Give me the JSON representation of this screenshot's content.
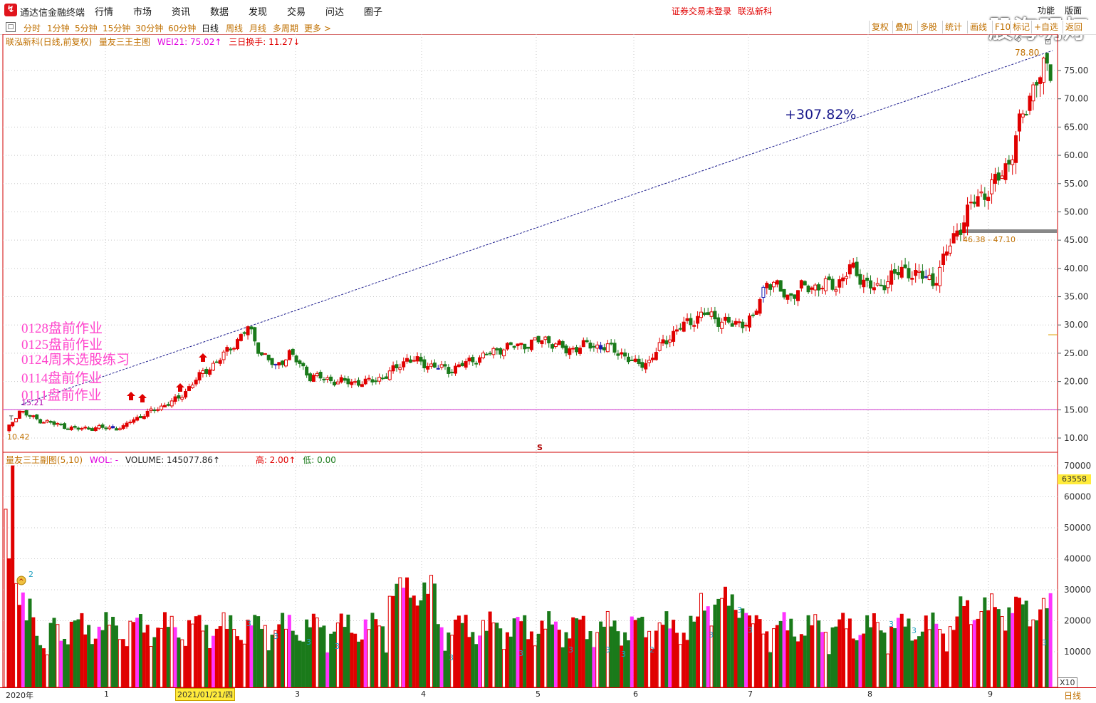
{
  "app": {
    "title": "通达信金融终端",
    "menu": [
      "行情",
      "市场",
      "资讯",
      "数据",
      "发现",
      "交易",
      "问达",
      "圈子"
    ],
    "status_login": "证券交易未登录",
    "stock_name": "联泓新科",
    "right_menu": [
      "功能",
      "版面"
    ],
    "watermark": "股海明灯"
  },
  "periods": [
    "分时",
    "1分钟",
    "5分钟",
    "15分钟",
    "30分钟",
    "60分钟",
    "日线",
    "周线",
    "月线",
    "多周期",
    "更多 >"
  ],
  "active_period": "日线",
  "toolbar": [
    "复权",
    "叠加",
    "多股",
    "统计",
    "画线",
    "F10",
    "标记",
    "+自选",
    "返回"
  ],
  "main_legend": {
    "title": "联泓新科(日线,前复权)",
    "indicator": "量友三王主图",
    "wei": "WEI21: 75.02↑",
    "turnover": "三日换手: 11.27↓"
  },
  "sub_legend": {
    "title": "量友三王副图(5,10)",
    "wol": "WOL: -",
    "volume": "VOLUME: 145077.86↑",
    "high": "高: 2.00↑",
    "low": "低: 0.00"
  },
  "homework": [
    "0128盘前作业",
    "0125盘前作业",
    "0124周末选股练习",
    "0114盘前作业",
    "0111盘前作业"
  ],
  "annotations": {
    "pct_change": "+307.82%",
    "high_price": "78.80",
    "low_price": "10.42",
    "start_price": "15.21",
    "gap_label": "46.38 - 47.10",
    "s_marker": "S",
    "t_marker": "T"
  },
  "price_axis": [
    "75.00",
    "70.00",
    "65.00",
    "60.00",
    "55.00",
    "50.00",
    "45.00",
    "40.00",
    "35.00",
    "30.00",
    "25.00",
    "20.00",
    "15.00",
    "10.00"
  ],
  "volume_axis": [
    "70000",
    "60000",
    "50000",
    "40000",
    "30000",
    "20000",
    "10000"
  ],
  "volume_badge": "63558",
  "x_axis": {
    "labels": [
      "2020年",
      "1",
      "3",
      "4",
      "5",
      "6",
      "7",
      "8",
      "9"
    ],
    "cursor_date": "2021/01/21/四",
    "zoom": "X10",
    "period_tag": "日线"
  },
  "colors": {
    "up": "#e00000",
    "down": "#1a7a1a",
    "neutral": "#1a1ab0",
    "magenta": "#ff33ff",
    "grid": "#c8c8c8",
    "accent": "#c07000"
  }
}
